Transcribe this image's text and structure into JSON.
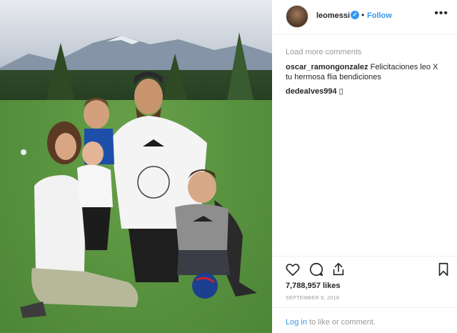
{
  "post": {
    "username": "leomessi",
    "verified_mark": "✓",
    "separator": "•",
    "follow_label": "Follow",
    "load_more_label": "Load more comments",
    "comments": [
      {
        "user": "oscar_ramongonzalez",
        "text": " Felicitaciones leo X tu hermosa flia bendiciones"
      },
      {
        "user": "dedealves994",
        "text": " ▯"
      }
    ],
    "likes": "7,788,957 likes",
    "date": "SEPTEMBER 9, 2018",
    "login_link": "Log in",
    "login_rest": " to like or comment.",
    "more_label": "•••"
  },
  "icons": {
    "like": "heart-icon",
    "comment": "comment-icon",
    "share": "share-icon",
    "save": "bookmark-icon"
  },
  "colors": {
    "accent": "#3897f0",
    "muted": "#999999",
    "text": "#262626"
  }
}
